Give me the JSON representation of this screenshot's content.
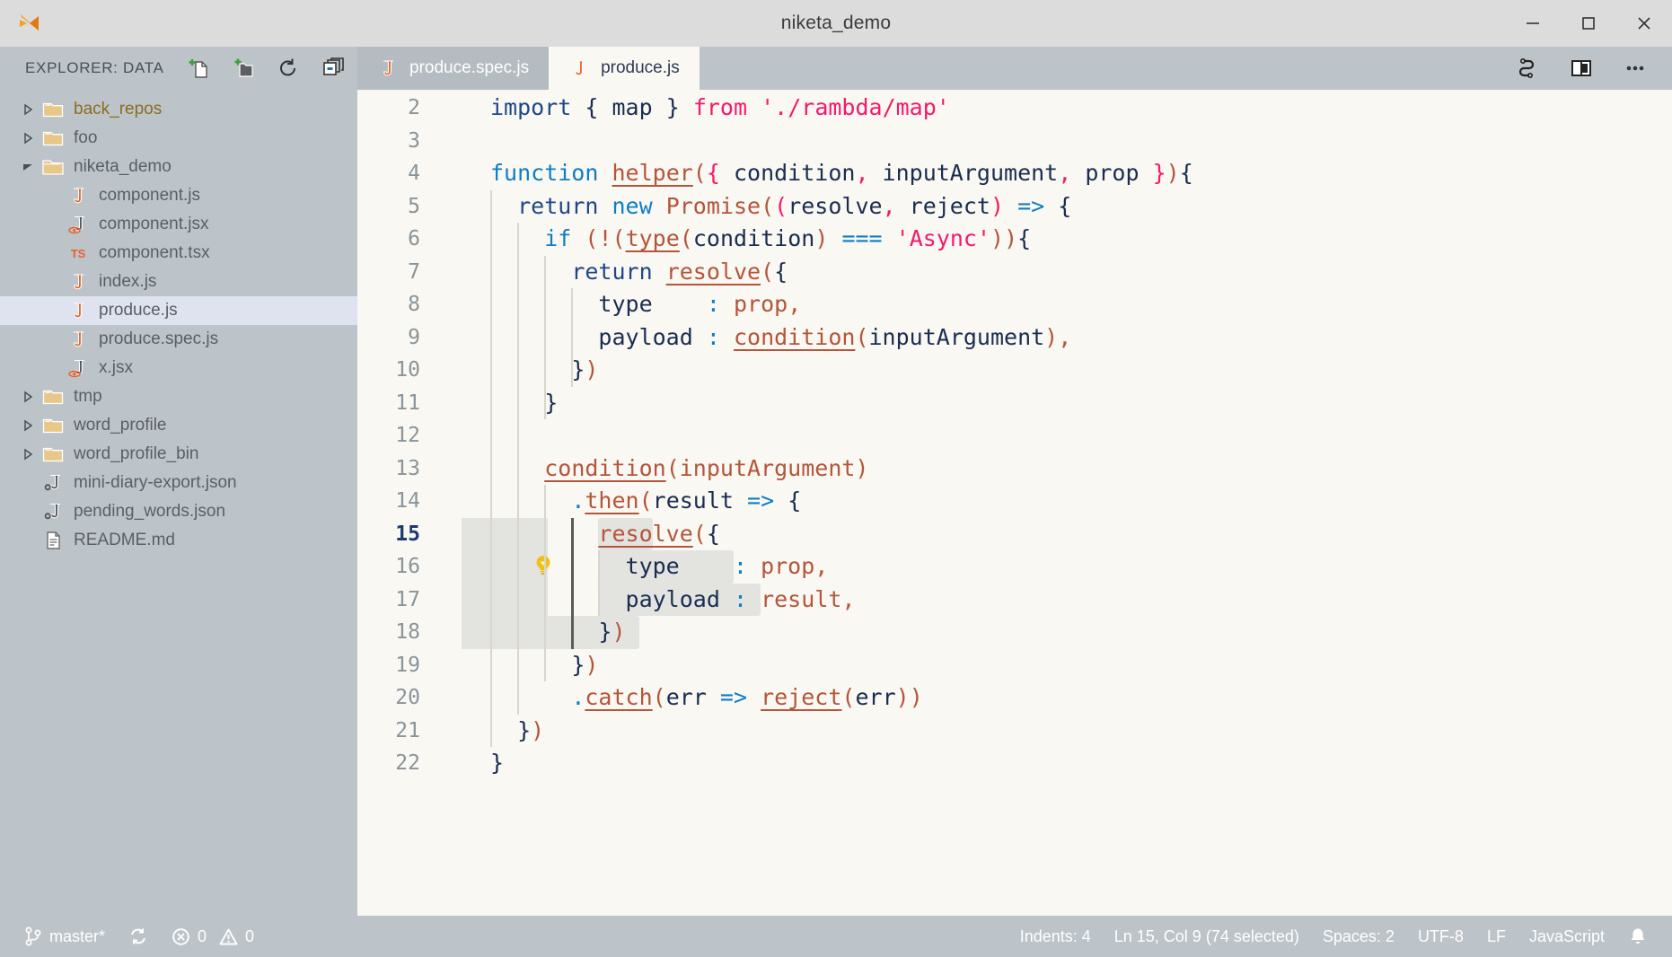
{
  "window": {
    "title": "niketa_demo",
    "logo_icon": "vscode-logo",
    "controls": [
      {
        "name": "minimize",
        "icon": "minimize-icon"
      },
      {
        "name": "maximize",
        "icon": "maximize-icon"
      },
      {
        "name": "close",
        "icon": "close-icon"
      }
    ]
  },
  "sidebar": {
    "title": "EXPLORER: DATA",
    "actions": [
      {
        "name": "new-file",
        "icon": "new-file-icon"
      },
      {
        "name": "new-folder",
        "icon": "new-folder-icon"
      },
      {
        "name": "refresh",
        "icon": "refresh-icon"
      },
      {
        "name": "collapse-all",
        "icon": "collapse-all-icon"
      }
    ],
    "tree": [
      {
        "label": "back_repos",
        "type": "folder",
        "expanded": false,
        "depth": 0,
        "accent": true
      },
      {
        "label": "foo",
        "type": "folder",
        "expanded": false,
        "depth": 0
      },
      {
        "label": "niketa_demo",
        "type": "folder",
        "expanded": true,
        "depth": 0
      },
      {
        "label": "component.js",
        "type": "js",
        "depth": 1
      },
      {
        "label": "component.jsx",
        "type": "jsx",
        "depth": 1
      },
      {
        "label": "component.tsx",
        "type": "tsx",
        "depth": 1
      },
      {
        "label": "index.js",
        "type": "js",
        "depth": 1
      },
      {
        "label": "produce.js",
        "type": "js",
        "depth": 1,
        "selected": true
      },
      {
        "label": "produce.spec.js",
        "type": "js",
        "depth": 1
      },
      {
        "label": "x.jsx",
        "type": "jsx",
        "depth": 1
      },
      {
        "label": "tmp",
        "type": "folder",
        "expanded": false,
        "depth": 0
      },
      {
        "label": "word_profile",
        "type": "folder",
        "expanded": false,
        "depth": 0
      },
      {
        "label": "word_profile_bin",
        "type": "folder",
        "expanded": false,
        "depth": 0
      },
      {
        "label": "mini-diary-export.json",
        "type": "json",
        "depth": 0
      },
      {
        "label": "pending_words.json",
        "type": "json",
        "depth": 0
      },
      {
        "label": "README.md",
        "type": "md",
        "depth": 0
      }
    ]
  },
  "tabs": [
    {
      "label": "produce.spec.js",
      "icon": "js-file-icon",
      "active": false
    },
    {
      "label": "produce.js",
      "icon": "js-file-icon",
      "active": true
    }
  ],
  "tab_actions": [
    {
      "name": "run-tests",
      "icon": "sync-alt-icon"
    },
    {
      "name": "split-editor",
      "icon": "split-editor-icon"
    },
    {
      "name": "more-actions",
      "icon": "ellipsis-icon"
    }
  ],
  "editor": {
    "lightbulb_line": 15,
    "lightbulb_icon": "lightbulb-icon",
    "lines": [
      {
        "no": "2",
        "indent": 0,
        "tokens": [
          {
            "t": "import",
            "c": "t-kw"
          },
          {
            "t": " ",
            "c": "t-punc"
          },
          {
            "t": "{",
            "c": "t-punc"
          },
          {
            "t": " map ",
            "c": "t-var"
          },
          {
            "t": "}",
            "c": "t-punc"
          },
          {
            "t": " ",
            "c": "t-punc"
          },
          {
            "t": "from",
            "c": "t-pink"
          },
          {
            "t": " ",
            "c": "t-punc"
          },
          {
            "t": "'./rambda/map'",
            "c": "t-str"
          }
        ]
      },
      {
        "no": "3",
        "indent": 0,
        "tokens": []
      },
      {
        "no": "4",
        "indent": 0,
        "tokens": [
          {
            "t": "function",
            "c": "t-kw2"
          },
          {
            "t": " ",
            "c": "t-punc"
          },
          {
            "t": "helper",
            "c": "t-fn"
          },
          {
            "t": "(",
            "c": "t-paren"
          },
          {
            "t": "{",
            "c": "t-pink"
          },
          {
            "t": " condition",
            "c": "t-var"
          },
          {
            "t": ",",
            "c": "t-pink"
          },
          {
            "t": " inputArgument",
            "c": "t-var"
          },
          {
            "t": ",",
            "c": "t-pink"
          },
          {
            "t": " prop ",
            "c": "t-var"
          },
          {
            "t": "}",
            "c": "t-pink"
          },
          {
            "t": ")",
            "c": "t-paren"
          },
          {
            "t": "{",
            "c": "t-punc"
          }
        ]
      },
      {
        "no": "5",
        "indent": 1,
        "tokens": [
          {
            "t": "  ",
            "c": "t-punc"
          },
          {
            "t": "return",
            "c": "t-kw"
          },
          {
            "t": " ",
            "c": "t-punc"
          },
          {
            "t": "new",
            "c": "t-kw2"
          },
          {
            "t": " ",
            "c": "t-punc"
          },
          {
            "t": "Promise",
            "c": "t-fn2"
          },
          {
            "t": "(",
            "c": "t-paren"
          },
          {
            "t": "(",
            "c": "t-pink"
          },
          {
            "t": "resolve",
            "c": "t-var"
          },
          {
            "t": ", ",
            "c": "t-pink"
          },
          {
            "t": "reject",
            "c": "t-var"
          },
          {
            "t": ")",
            "c": "t-pink"
          },
          {
            "t": " ",
            "c": "t-punc"
          },
          {
            "t": "=>",
            "c": "t-op"
          },
          {
            "t": " ",
            "c": "t-punc"
          },
          {
            "t": "{",
            "c": "t-punc"
          }
        ]
      },
      {
        "no": "6",
        "indent": 2,
        "tokens": [
          {
            "t": "    ",
            "c": "t-punc"
          },
          {
            "t": "if",
            "c": "t-kw2"
          },
          {
            "t": " ",
            "c": "t-punc"
          },
          {
            "t": "(",
            "c": "t-paren"
          },
          {
            "t": "!",
            "c": "t-paren"
          },
          {
            "t": "(",
            "c": "t-paren"
          },
          {
            "t": "type",
            "c": "t-fn"
          },
          {
            "t": "(",
            "c": "t-paren"
          },
          {
            "t": "condition",
            "c": "t-var"
          },
          {
            "t": ")",
            "c": "t-paren"
          },
          {
            "t": " ",
            "c": "t-punc"
          },
          {
            "t": "===",
            "c": "t-op"
          },
          {
            "t": " ",
            "c": "t-punc"
          },
          {
            "t": "'Async'",
            "c": "t-str"
          },
          {
            "t": ")",
            "c": "t-paren"
          },
          {
            "t": ")",
            "c": "t-paren"
          },
          {
            "t": "{",
            "c": "t-punc"
          }
        ]
      },
      {
        "no": "7",
        "indent": 3,
        "tokens": [
          {
            "t": "      ",
            "c": "t-punc"
          },
          {
            "t": "return",
            "c": "t-kw"
          },
          {
            "t": " ",
            "c": "t-punc"
          },
          {
            "t": "resolve",
            "c": "t-fn"
          },
          {
            "t": "(",
            "c": "t-paren"
          },
          {
            "t": "{",
            "c": "t-punc"
          }
        ]
      },
      {
        "no": "8",
        "indent": 4,
        "tokens": [
          {
            "t": "        ",
            "c": "t-punc"
          },
          {
            "t": "type",
            "c": "t-var"
          },
          {
            "t": "    ",
            "c": "t-punc"
          },
          {
            "t": ":",
            "c": "t-colon"
          },
          {
            "t": " ",
            "c": "t-punc"
          },
          {
            "t": "prop",
            "c": "t-fn2"
          },
          {
            "t": ",",
            "c": "t-fn2"
          }
        ]
      },
      {
        "no": "9",
        "indent": 4,
        "tokens": [
          {
            "t": "        ",
            "c": "t-punc"
          },
          {
            "t": "payload",
            "c": "t-var"
          },
          {
            "t": " ",
            "c": "t-punc"
          },
          {
            "t": ":",
            "c": "t-colon"
          },
          {
            "t": " ",
            "c": "t-punc"
          },
          {
            "t": "condition",
            "c": "t-fn"
          },
          {
            "t": "(",
            "c": "t-paren"
          },
          {
            "t": "inputArgument",
            "c": "t-var"
          },
          {
            "t": ")",
            "c": "t-paren"
          },
          {
            "t": ",",
            "c": "t-fn2"
          }
        ]
      },
      {
        "no": "10",
        "indent": 3,
        "tokens": [
          {
            "t": "      ",
            "c": "t-punc"
          },
          {
            "t": "}",
            "c": "t-punc"
          },
          {
            "t": ")",
            "c": "t-paren"
          }
        ]
      },
      {
        "no": "11",
        "indent": 2,
        "tokens": [
          {
            "t": "    ",
            "c": "t-punc"
          },
          {
            "t": "}",
            "c": "t-punc"
          }
        ]
      },
      {
        "no": "12",
        "indent": 0,
        "tokens": []
      },
      {
        "no": "13",
        "indent": 2,
        "tokens": [
          {
            "t": "    ",
            "c": "t-punc"
          },
          {
            "t": "condition",
            "c": "t-fn"
          },
          {
            "t": "(",
            "c": "t-paren"
          },
          {
            "t": "inputArgument",
            "c": "t-fn2"
          },
          {
            "t": ")",
            "c": "t-paren"
          }
        ]
      },
      {
        "no": "14",
        "indent": 3,
        "tokens": [
          {
            "t": "      ",
            "c": "t-punc"
          },
          {
            "t": ".",
            "c": "t-op"
          },
          {
            "t": "then",
            "c": "t-fn"
          },
          {
            "t": "(",
            "c": "t-paren"
          },
          {
            "t": "result",
            "c": "t-var"
          },
          {
            "t": " ",
            "c": "t-punc"
          },
          {
            "t": "=>",
            "c": "t-op"
          },
          {
            "t": " ",
            "c": "t-punc"
          },
          {
            "t": "{",
            "c": "t-punc"
          }
        ]
      },
      {
        "no": "15",
        "indent": 4,
        "active": true,
        "tokens": [
          {
            "t": "        ",
            "c": "t-punc"
          },
          {
            "t": "resolve",
            "c": "t-fn"
          },
          {
            "t": "(",
            "c": "t-paren"
          },
          {
            "t": "{",
            "c": "t-punc"
          }
        ]
      },
      {
        "no": "16",
        "indent": 5,
        "tokens": [
          {
            "t": "          ",
            "c": "t-punc"
          },
          {
            "t": "type",
            "c": "t-var"
          },
          {
            "t": "    ",
            "c": "t-punc"
          },
          {
            "t": ":",
            "c": "t-colon"
          },
          {
            "t": " ",
            "c": "t-punc"
          },
          {
            "t": "prop",
            "c": "t-fn2"
          },
          {
            "t": ",",
            "c": "t-fn2"
          }
        ]
      },
      {
        "no": "17",
        "indent": 5,
        "tokens": [
          {
            "t": "          ",
            "c": "t-punc"
          },
          {
            "t": "payload",
            "c": "t-var"
          },
          {
            "t": " ",
            "c": "t-punc"
          },
          {
            "t": ":",
            "c": "t-colon"
          },
          {
            "t": " ",
            "c": "t-punc"
          },
          {
            "t": "result",
            "c": "t-fn2"
          },
          {
            "t": ",",
            "c": "t-fn2"
          }
        ]
      },
      {
        "no": "18",
        "indent": 4,
        "tokens": [
          {
            "t": "        ",
            "c": "t-punc"
          },
          {
            "t": "}",
            "c": "t-punc"
          },
          {
            "t": ")",
            "c": "t-paren"
          }
        ]
      },
      {
        "no": "19",
        "indent": 3,
        "tokens": [
          {
            "t": "      ",
            "c": "t-punc"
          },
          {
            "t": "}",
            "c": "t-punc"
          },
          {
            "t": ")",
            "c": "t-paren"
          }
        ]
      },
      {
        "no": "20",
        "indent": 3,
        "tokens": [
          {
            "t": "      ",
            "c": "t-punc"
          },
          {
            "t": ".",
            "c": "t-op"
          },
          {
            "t": "catch",
            "c": "t-fn"
          },
          {
            "t": "(",
            "c": "t-paren"
          },
          {
            "t": "err",
            "c": "t-var"
          },
          {
            "t": " ",
            "c": "t-punc"
          },
          {
            "t": "=>",
            "c": "t-op"
          },
          {
            "t": " ",
            "c": "t-punc"
          },
          {
            "t": "reject",
            "c": "t-fn"
          },
          {
            "t": "(",
            "c": "t-paren"
          },
          {
            "t": "err",
            "c": "t-var"
          },
          {
            "t": ")",
            "c": "t-paren"
          },
          {
            "t": ")",
            "c": "t-paren"
          }
        ]
      },
      {
        "no": "21",
        "indent": 1,
        "tokens": [
          {
            "t": "  ",
            "c": "t-punc"
          },
          {
            "t": "}",
            "c": "t-punc"
          },
          {
            "t": ")",
            "c": "t-paren"
          }
        ]
      },
      {
        "no": "22",
        "indent": 0,
        "tokens": [
          {
            "t": "}",
            "c": "t-punc"
          }
        ]
      }
    ]
  },
  "statusbar": {
    "left": [
      {
        "name": "branch",
        "icon": "source-control-icon",
        "label": "master*"
      },
      {
        "name": "sync",
        "icon": "sync-icon",
        "label": ""
      },
      {
        "name": "problems",
        "icon": "error-warning-icon",
        "errors": "0",
        "warnings": "0"
      }
    ],
    "right": [
      {
        "name": "indents",
        "label": "Indents: 4"
      },
      {
        "name": "cursor-position",
        "label": "Ln 15, Col 9 (74 selected)"
      },
      {
        "name": "spaces",
        "label": "Spaces: 2"
      },
      {
        "name": "encoding",
        "label": "UTF-8"
      },
      {
        "name": "eol",
        "label": "LF"
      },
      {
        "name": "language-mode",
        "label": "JavaScript"
      },
      {
        "name": "notifications",
        "icon": "bell-icon",
        "label": ""
      }
    ]
  },
  "colors": {
    "titlebar_bg": "#dcdcdc",
    "sidebar_bg": "#bdc4c9",
    "editor_bg": "#f9f8f3",
    "selected_row": "#dfe2ef",
    "accent_orange": "#e8622a",
    "folder_yellow": "#e8c88a",
    "selection_highlight": "#e3e3e0"
  }
}
